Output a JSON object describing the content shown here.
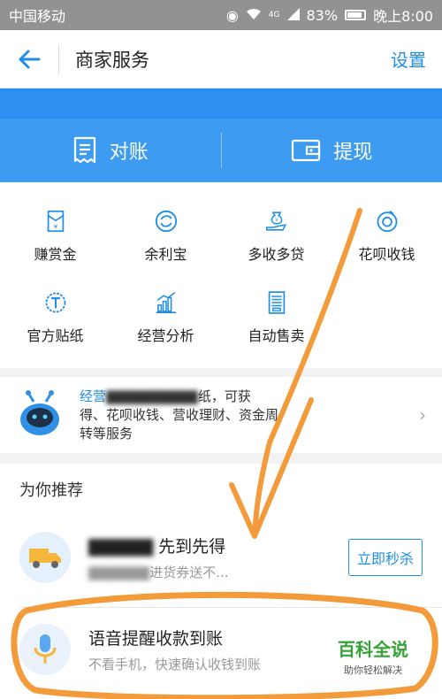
{
  "status_bar": {
    "carrier": "中国移动",
    "battery": "83%",
    "time": "晚上8:00",
    "network": "4G"
  },
  "header": {
    "title": "商家服务",
    "settings_label": "设置"
  },
  "actions": [
    {
      "label": "对账",
      "icon": "statement-icon"
    },
    {
      "label": "提现",
      "icon": "wallet-icon"
    }
  ],
  "services": [
    {
      "label": "赚赏金",
      "icon": "envelope-yen-icon"
    },
    {
      "label": "余利宝",
      "icon": "yulibao-icon"
    },
    {
      "label": "多收多贷",
      "icon": "money-bag-hand-icon"
    },
    {
      "label": "花呗收钱",
      "icon": "huabei-icon"
    },
    {
      "label": "官方贴纸",
      "icon": "sticker-t-icon"
    },
    {
      "label": "经营分析",
      "icon": "bar-chart-icon"
    },
    {
      "label": "自动售卖",
      "icon": "vending-icon"
    }
  ],
  "promo": {
    "highlight": "经营",
    "line1_tail": "纸，可获",
    "line2": "得、花呗收钱、营收理财、资金周",
    "line3": "转等服务",
    "icon": "robot-icon"
  },
  "recommend": {
    "title": "为你推荐",
    "items": [
      {
        "title": "先到先得",
        "subtitle": "进货券送不...",
        "button": "立即秒杀",
        "icon": "truck-icon"
      },
      {
        "title": "语音提醒收款到账",
        "subtitle": "不看手机，快速确认收钱到账",
        "icon": "microphone-icon"
      }
    ]
  },
  "watermark": {
    "main": "百科全说",
    "sub": "助你轻松解决"
  },
  "colors": {
    "accent": "#1e8ee8",
    "action_bar": "#3d9cf2",
    "status_bar": "#929292",
    "annotation": "#f39a3a",
    "watermark": "#33a335"
  }
}
